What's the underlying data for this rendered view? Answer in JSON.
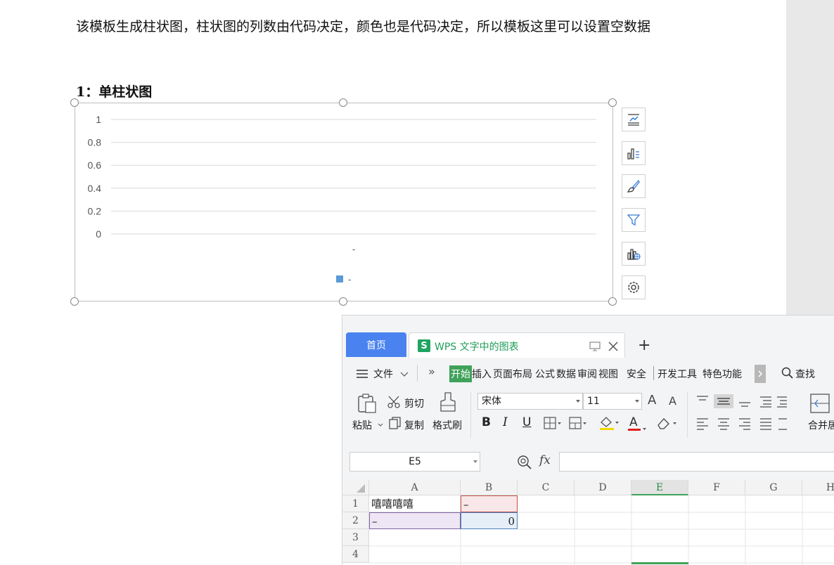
{
  "document": {
    "paragraph": "该模板生成柱状图，柱状图的列数由代码决定，颜色也是代码决定，所以模板这里可以设置空数据",
    "heading": "1：单柱状图"
  },
  "chart_data": {
    "type": "bar",
    "categories": [
      "-"
    ],
    "series": [
      {
        "name": "-",
        "values": [
          0
        ],
        "color": "#5b9bd5"
      }
    ],
    "ylim": [
      0,
      1
    ],
    "yticks": [
      "0",
      "0.2",
      "0.4",
      "0.6",
      "0.8",
      "1"
    ],
    "grid": true,
    "legend": "bottom"
  },
  "chart_tools": [
    "chart-elements-icon",
    "chart-style-icon",
    "chart-brush-icon",
    "chart-filter-icon",
    "chart-online-icon",
    "chart-settings-icon"
  ],
  "wps": {
    "tabs": {
      "home": "首页",
      "doc_badge": "S",
      "doc_title": "WPS 文字中的图表",
      "plus": "+"
    },
    "menu": {
      "file": "文件",
      "more": "»",
      "items": [
        "开始",
        "插入",
        "页面布局",
        "公式",
        "数据",
        "审阅",
        "视图",
        "安全",
        "开发工具",
        "特色功能"
      ],
      "search": "查找"
    },
    "ribbon": {
      "paste": "粘贴",
      "cut": "剪切",
      "copy": "复制",
      "format_painter": "格式刷",
      "font_name": "宋体",
      "font_size": "11",
      "bold": "B",
      "italic": "I",
      "underline": "U",
      "font_color_letter": "A",
      "grow_font": "A",
      "shrink_font": "A",
      "merge": "合并居"
    },
    "formula_bar": {
      "cell_ref": "E5",
      "fx": "fx",
      "value": ""
    },
    "sheet": {
      "columns": [
        "A",
        "B",
        "C",
        "D",
        "E",
        "F",
        "G",
        "H"
      ],
      "rows": [
        "1",
        "2",
        "3",
        "4"
      ],
      "cells": {
        "A1": "嘻嘻嘻嘻",
        "B1": "–",
        "A2": "–",
        "B2": "0"
      },
      "selected_column": "E"
    },
    "colors": {
      "accent_blue": "#4a82f0",
      "active_green": "#3fa25a",
      "doc_green": "#1fa463"
    }
  }
}
